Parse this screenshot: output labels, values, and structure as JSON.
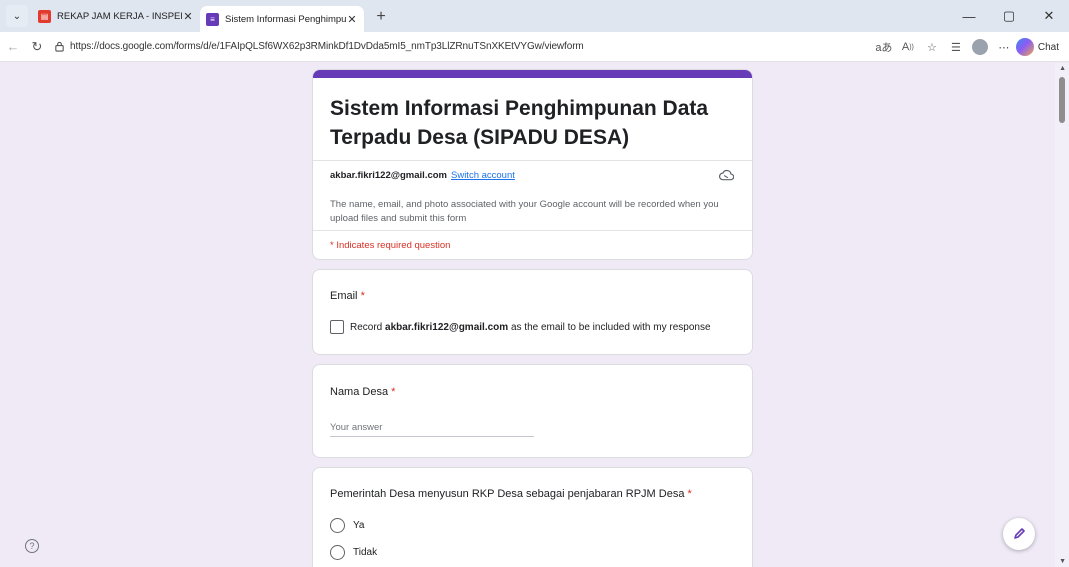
{
  "browser": {
    "tabs": [
      {
        "title": "REKAP JAM KERJA - INSPEKTORAT",
        "close": "✕",
        "favicon": "pdf-icon",
        "active": false
      },
      {
        "title": "Sistem Informasi Penghimpunan D",
        "close": "✕",
        "favicon": "google-forms-icon",
        "active": true
      }
    ],
    "new_tab": "+",
    "window_controls": {
      "minimize": "—",
      "maximize": "▢",
      "close": "✕"
    },
    "url": "https://docs.google.com/forms/d/e/1FAIpQLSf6WX62p3RMinkDf1DvDda5mI5_nmTp3LlZRnuTSnXKEtVYGw/viewform",
    "chat_label": "Chat",
    "accent_color": "#673ab7"
  },
  "form": {
    "title": "Sistem Informasi Penghimpunan Data Terpadu Desa (SIPADU DESA)",
    "account_email": "akbar.fikri122@gmail.com",
    "switch_account": "Switch account",
    "notice": "The name, email, and photo associated with your Google account will be recorded when you upload files and submit this form",
    "required_note": "* Indicates required question",
    "required_color": "#d93025",
    "questions": {
      "email": {
        "label": "Email",
        "star": "*",
        "checkbox_label_prefix": "Record ",
        "checkbox_label_email": "akbar.fikri122@gmail.com",
        "checkbox_label_suffix": " as the email to be included with my response"
      },
      "nama_desa": {
        "label": "Nama Desa",
        "star": "*",
        "placeholder": "Your answer",
        "value": ""
      },
      "rkp": {
        "label": "Pemerintah Desa menyusun RKP Desa sebagai penjabaran RPJM Desa",
        "star": "*",
        "options": [
          "Ya",
          "Tidak"
        ]
      }
    }
  },
  "help": "?"
}
